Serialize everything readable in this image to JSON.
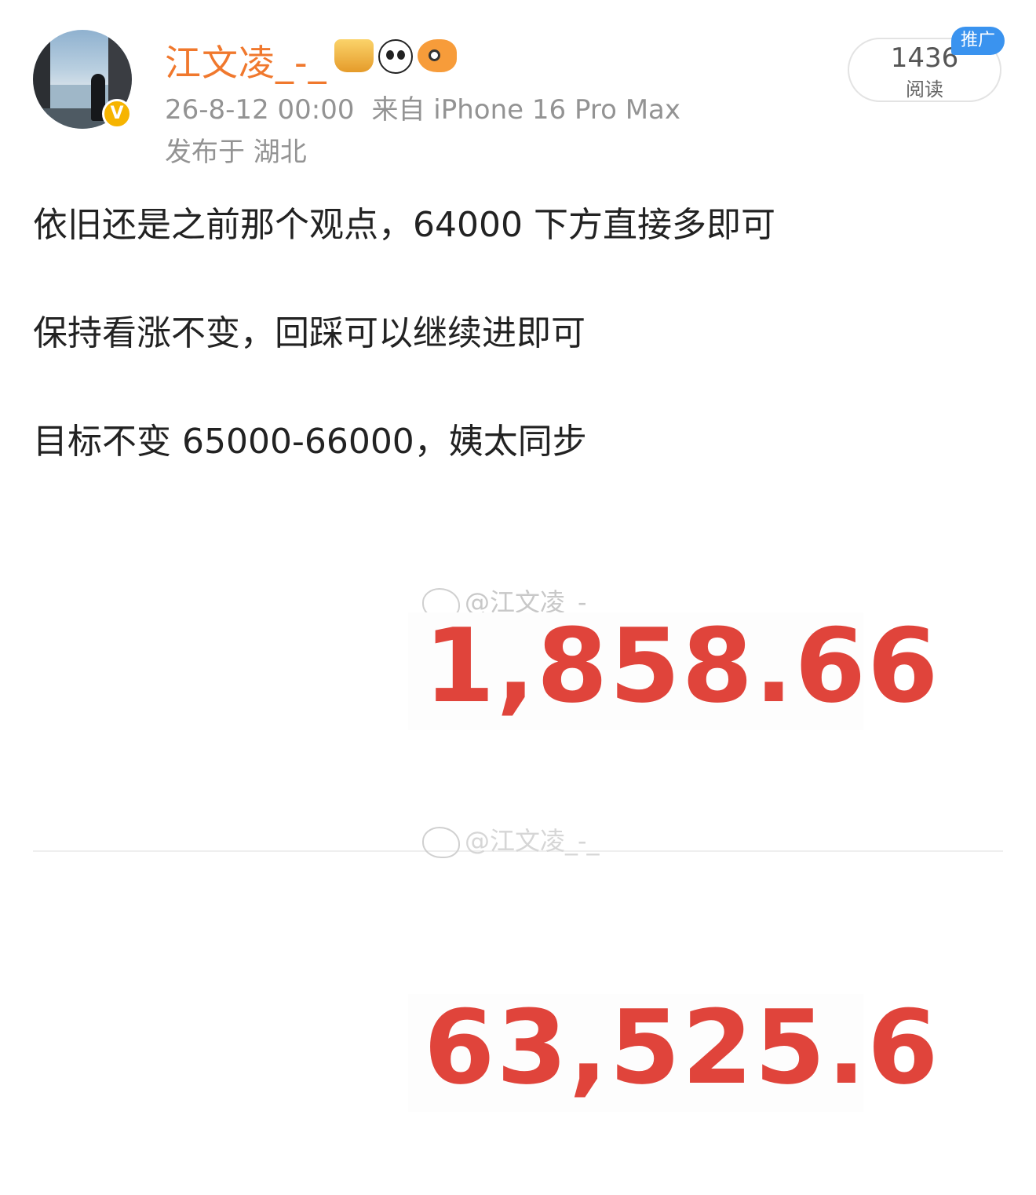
{
  "author": {
    "name": "江文凌_-_",
    "verified_mark": "V",
    "badges": [
      "crown-badge-icon",
      "panda-badge-icon",
      "fish-badge-icon"
    ]
  },
  "meta": {
    "time": "26-8-12 00:00",
    "source": "来自 iPhone 16 Pro Max",
    "location": "发布于 湖北"
  },
  "reads": {
    "count": "1436",
    "label": "阅读",
    "promo": "推广"
  },
  "post": {
    "lines": [
      "依旧还是之前那个观点，64000 下方直接多即可",
      "保持看涨不变，回踩可以继续进即可",
      "目标不变 65000-66000，姨太同步"
    ]
  },
  "images": [
    {
      "watermark": "@江文凌_-_",
      "value": "1,858.66"
    },
    {
      "watermark": "@江文凌_-_",
      "value": "63,525.6"
    }
  ],
  "colors": {
    "username": "#f0782d",
    "number": "#e0443b",
    "meta": "#939393",
    "promo": "#3a93ef"
  }
}
